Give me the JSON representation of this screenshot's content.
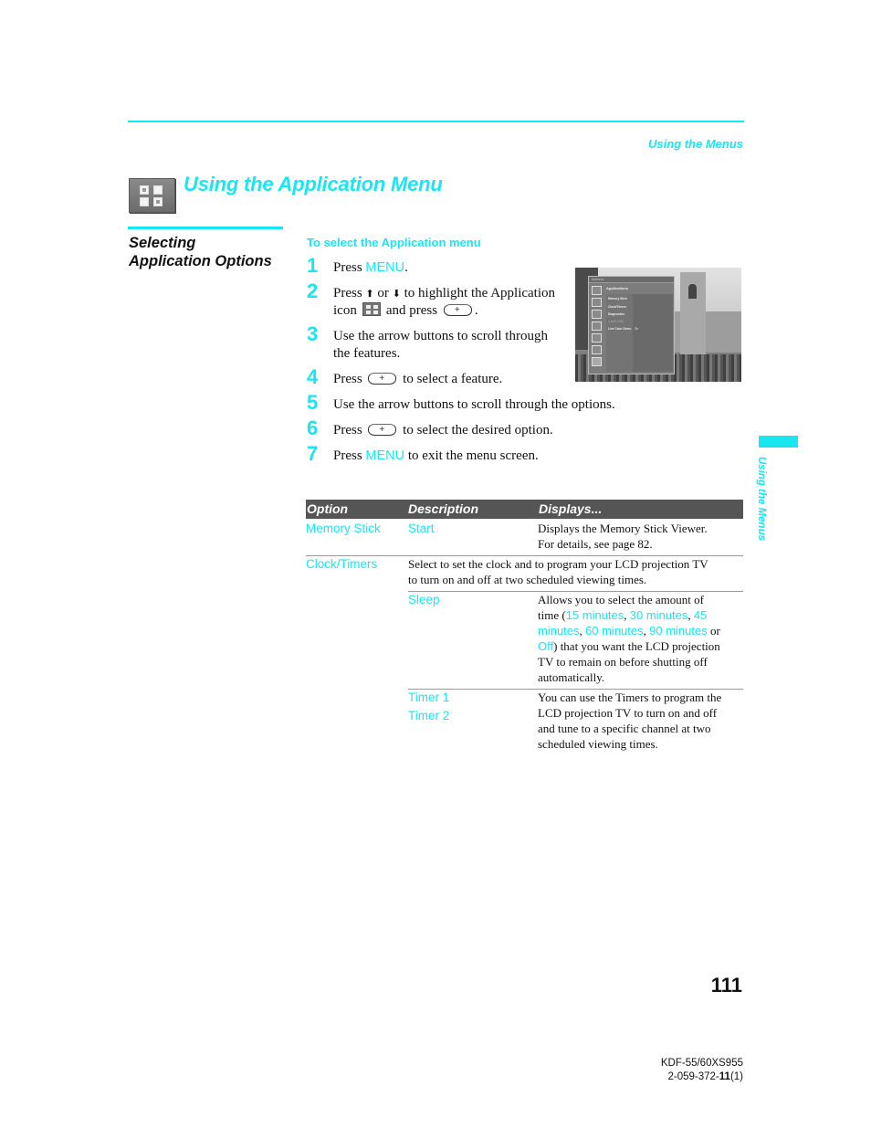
{
  "header": {
    "running_head": "Using the Menus"
  },
  "title": {
    "icon": "application-icon",
    "text": "Using the Application Menu"
  },
  "section": {
    "title_line1": "Selecting",
    "title_line2": "Application Options"
  },
  "procedure": {
    "heading": "To select the Application menu",
    "steps": [
      {
        "num": "1",
        "pre": "Press ",
        "kw": "MENU",
        "post": "."
      },
      {
        "num": "2",
        "pre": "Press ",
        "up_arrow": "⬆",
        "mid": " or ",
        "down_arrow": "⬇",
        "post": " to highlight the Application",
        "line2_pre": "icon",
        "line2_mid": "and press",
        "line2_post": "."
      },
      {
        "num": "3",
        "line1": "Use the arrow buttons to scroll through",
        "line2": "the features."
      },
      {
        "num": "4",
        "pre": "Press",
        "post": "to select a feature."
      },
      {
        "num": "5",
        "line1": "Use the arrow buttons to scroll through the options."
      },
      {
        "num": "6",
        "pre": "Press",
        "post": "to select the desired option."
      },
      {
        "num": "7",
        "pre": "Press ",
        "kw": "MENU",
        "post": " to exit the menu screen."
      }
    ]
  },
  "screenshot": {
    "bar_label": "Antenna",
    "menu_title": "Applications",
    "items": [
      {
        "label": "Memory Stick",
        "value": ""
      },
      {
        "label": "Clock/Timers",
        "value": ""
      },
      {
        "label": "Diagnostics",
        "value": ""
      },
      {
        "label": "CableCARD",
        "value": "",
        "dimmed": true
      },
      {
        "label": "Live Color Demo",
        "value": "On"
      }
    ]
  },
  "table": {
    "headers": [
      "Option",
      "Description",
      "Displays..."
    ],
    "rows": [
      {
        "option": "Memory Stick",
        "description": "Start",
        "displays_line1": "Displays the Memory Stick Viewer.",
        "displays_line2": "For details, see page 82."
      },
      {
        "option": "Clock/Timers",
        "description_line1": "Select to set the clock and to program your LCD projection TV",
        "description_line2": "to turn on and off at two scheduled viewing times.",
        "subrows": [
          {
            "description": "Sleep",
            "displays": {
              "l1": "Allows you to select the amount of",
              "l2_pre": "time (",
              "opt15": "15 minutes",
              "opt30": "30 minutes",
              "opt45a": "45",
              "opt45b": "minutes",
              "opt60": "60 minutes",
              "opt90": "90 minutes",
              "or": " or",
              "off": "Off",
              "l5_post": ") that you want the LCD projection",
              "l6": "TV to remain on before shutting off",
              "l7": "automatically."
            }
          },
          {
            "description_1": "Timer 1",
            "description_2": "Timer 2",
            "displays_lines": [
              "You can use the Timers to program the",
              "LCD projection TV to turn on and off",
              "and tune to a specific channel at two",
              "scheduled viewing times."
            ]
          }
        ]
      }
    ]
  },
  "side_tab": {
    "label": "Using the Menus"
  },
  "footer": {
    "page_number": "111",
    "model": "KDF-55/60XS955",
    "part_pre": "2-059-372-",
    "part_bold": "11",
    "part_post": "(1)"
  },
  "colors": {
    "accent": "#19e6f0",
    "table_header_bg": "#555555"
  }
}
